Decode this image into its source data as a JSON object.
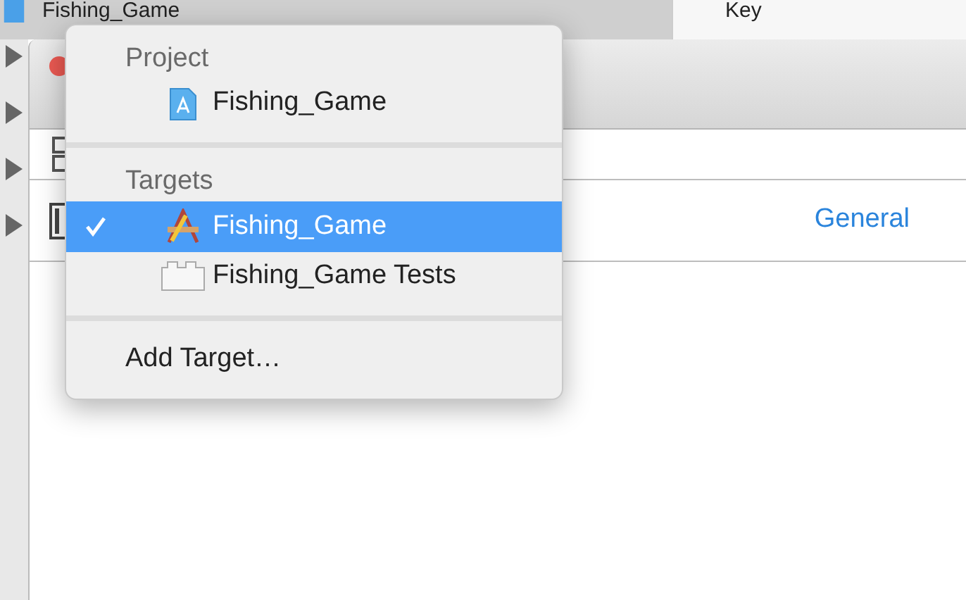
{
  "background": {
    "file_title": "Fishing_Game",
    "column_header": "Key",
    "tab": "General"
  },
  "menu": {
    "sections": [
      {
        "header": "Project",
        "items": [
          {
            "label": "Fishing_Game",
            "kind": "project",
            "selected": false,
            "checked": false
          }
        ]
      },
      {
        "header": "Targets",
        "items": [
          {
            "label": "Fishing_Game",
            "kind": "app",
            "selected": true,
            "checked": true
          },
          {
            "label": "Fishing_Game Tests",
            "kind": "tests",
            "selected": false,
            "checked": false
          }
        ]
      },
      {
        "items": [
          {
            "label": "Add Target…",
            "kind": "action",
            "selected": false,
            "checked": false
          }
        ]
      }
    ]
  }
}
